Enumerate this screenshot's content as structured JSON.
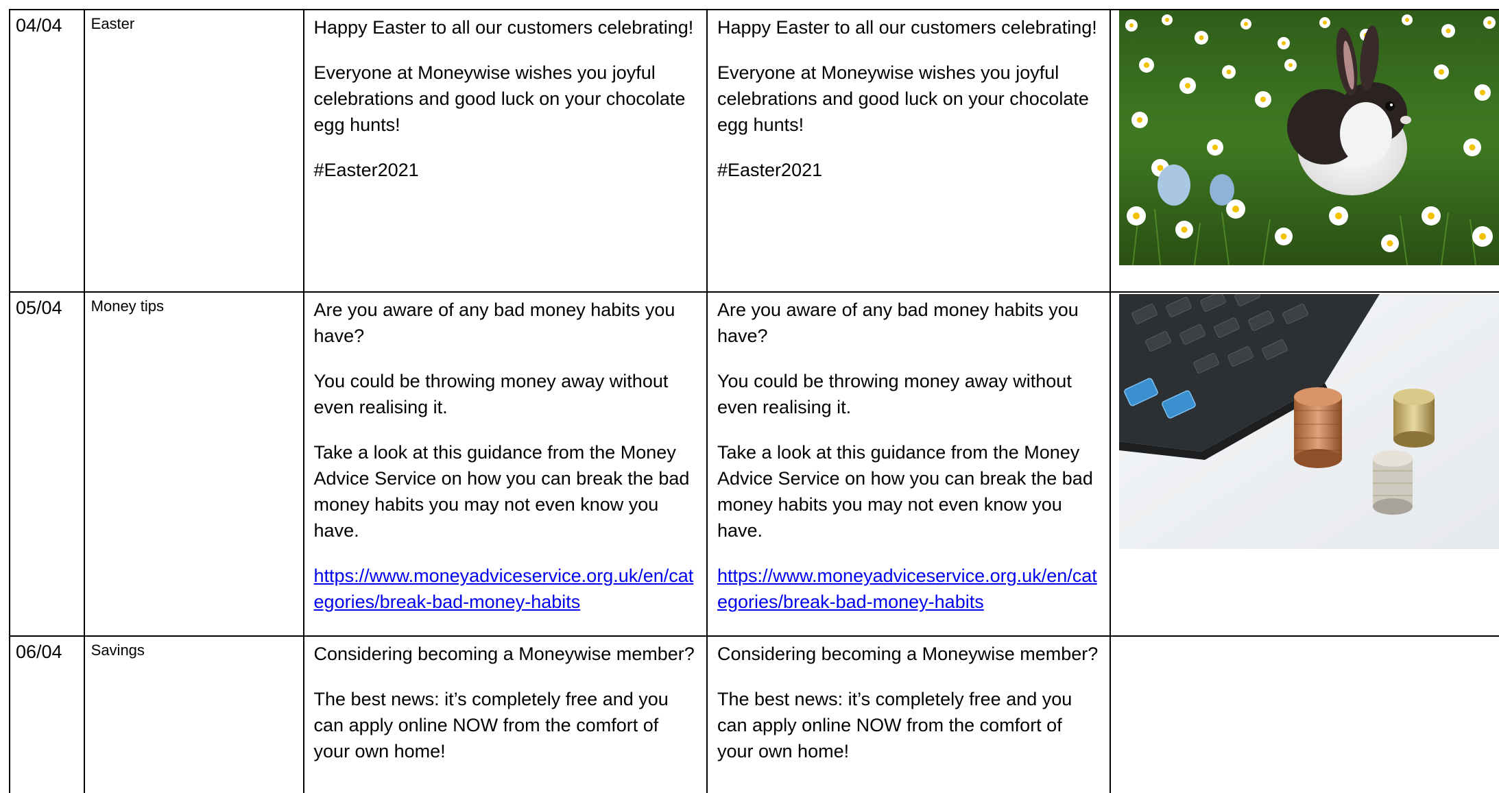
{
  "rows": [
    {
      "date": "04/04",
      "topic": "Easter",
      "copy_a": [
        "Happy Easter to all our customers celebrating!",
        "Everyone at Moneywise wishes you joyful celebrations and good luck on your chocolate egg hunts!",
        "#Easter2021"
      ],
      "copy_b": [
        "Happy Easter to all our customers celebrating!",
        "Everyone at Moneywise wishes you joyful celebrations and good luck on your chocolate egg hunts!",
        "#Easter2021"
      ],
      "image": "easter-bunny-in-daisies-photo"
    },
    {
      "date": "05/04",
      "topic": "Money tips",
      "copy_a": [
        "Are you aware of any bad money habits you have?",
        "You could be throwing money away without even realising it.",
        "Take a look at this guidance from the Money Advice Service on how you can break the bad money habits you may not even know you have."
      ],
      "link_a": "https://www.moneyadviceservice.org.uk/en/categories/break-bad-money-habits",
      "copy_b": [
        "Are you aware of any bad money habits you have?",
        "You could be throwing money away without even realising it.",
        "Take a look at this guidance from the Money Advice Service on how you can break the bad money habits you may not even know you have."
      ],
      "link_b": "https://www.moneyadviceservice.org.uk/en/categories/break-bad-money-habits",
      "image": "calculator-and-coins-photo"
    },
    {
      "date": "06/04",
      "topic": "Savings",
      "copy_a": [
        "Considering becoming a Moneywise member?",
        "The best news: it’s completely free and you can apply online NOW from the comfort of your own home!"
      ],
      "copy_b": [
        "Considering becoming a Moneywise member?",
        "The best news: it’s completely free and you can apply online NOW from the comfort of your own home!"
      ]
    }
  ],
  "colors": {
    "link": "#0000EE",
    "border": "#000000",
    "text": "#000000"
  }
}
